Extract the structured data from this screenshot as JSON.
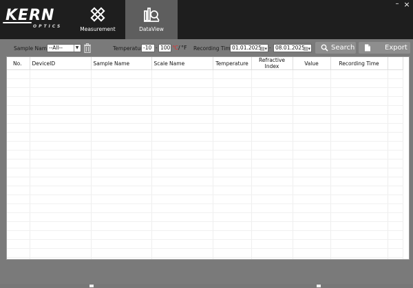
{
  "brand": {
    "name": "KERN",
    "sub": "OPTICS"
  },
  "nav": [
    {
      "label": "Measurement",
      "icon": "ruler-pencil-icon"
    },
    {
      "label": "DataView",
      "icon": "chart-magnifier-icon",
      "active": true
    }
  ],
  "window": {
    "minimize": "–",
    "close": "×"
  },
  "filters": {
    "sample_name_label": "Sample Name:",
    "sample_name_value": "--All--",
    "temperature_label": "Temperature",
    "temp_min": "-10",
    "temp_max": "100",
    "range_dash": "-",
    "unit_c": "℃",
    "unit_sep": "/",
    "unit_f": "°F",
    "recording_time_label": "Recording Time",
    "date_from": "01.01.2025",
    "date_to": "08.01.2025"
  },
  "buttons": {
    "search": "Search",
    "export": "Export"
  },
  "table": {
    "columns": [
      "No.",
      "DeviceID",
      "Sample Name",
      "Scale Name",
      "Temperature",
      "Refractive Index",
      "Value",
      "Recording Time"
    ],
    "rows": []
  },
  "colors": {
    "topbar": "#1e1e1e",
    "active_tab": "#5e5e5e",
    "body": "#7a7a7a",
    "celsius": "#e03030"
  }
}
